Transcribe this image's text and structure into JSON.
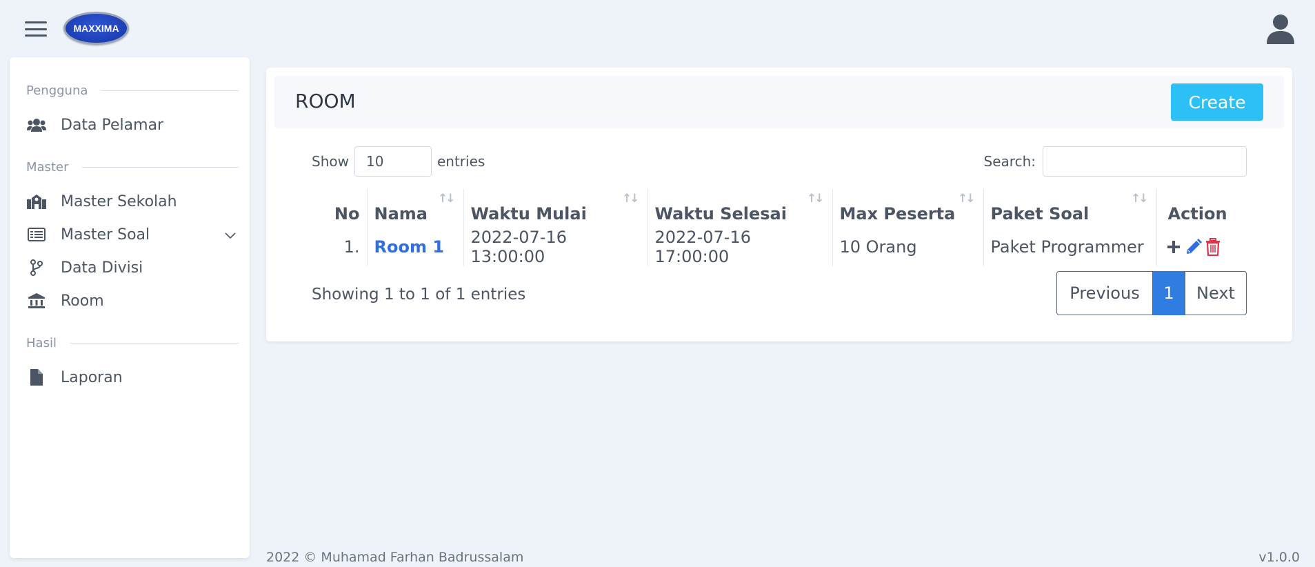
{
  "brand": {
    "logo_text": "MAXXIMA"
  },
  "sidebar": {
    "sections": [
      {
        "label": "Pengguna"
      },
      {
        "label": "Master"
      },
      {
        "label": "Hasil"
      }
    ],
    "items": [
      {
        "label": "Data Pelamar",
        "icon": "users-icon"
      },
      {
        "label": "Master Sekolah",
        "icon": "school-icon"
      },
      {
        "label": "Master Soal",
        "icon": "list-icon"
      },
      {
        "label": "Data Divisi",
        "icon": "branch-icon"
      },
      {
        "label": "Room",
        "icon": "bank-icon"
      },
      {
        "label": "Laporan",
        "icon": "file-icon"
      }
    ]
  },
  "page": {
    "title": "ROOM",
    "create_label": "Create"
  },
  "table_controls": {
    "show_label": "Show",
    "entries_value": "10",
    "entries_label": "entries",
    "search_label": "Search:",
    "search_value": ""
  },
  "table": {
    "headers": [
      "No",
      "Nama",
      "Waktu Mulai",
      "Waktu Selesai",
      "Max Peserta",
      "Paket Soal",
      "Action"
    ],
    "rows": [
      {
        "no": "1.",
        "nama": "Room 1",
        "waktu_mulai": "2022-07-16 13:00:00",
        "waktu_selesai": "2022-07-16 17:00:00",
        "max_peserta": "10 Orang",
        "paket_soal": "Paket Programmer"
      }
    ]
  },
  "pagination": {
    "info": "Showing 1 to 1 of 1 entries",
    "previous": "Previous",
    "current": "1",
    "next": "Next"
  },
  "footer": {
    "copyright": "2022 © Muhamad Farhan Badrussalam",
    "version": "v1.0.0"
  },
  "colors": {
    "accent": "#2cc0f6",
    "link": "#2f6fdf",
    "pagination_active": "#2f7de1",
    "delete": "#e0334a",
    "edit": "#2f6fdf"
  }
}
